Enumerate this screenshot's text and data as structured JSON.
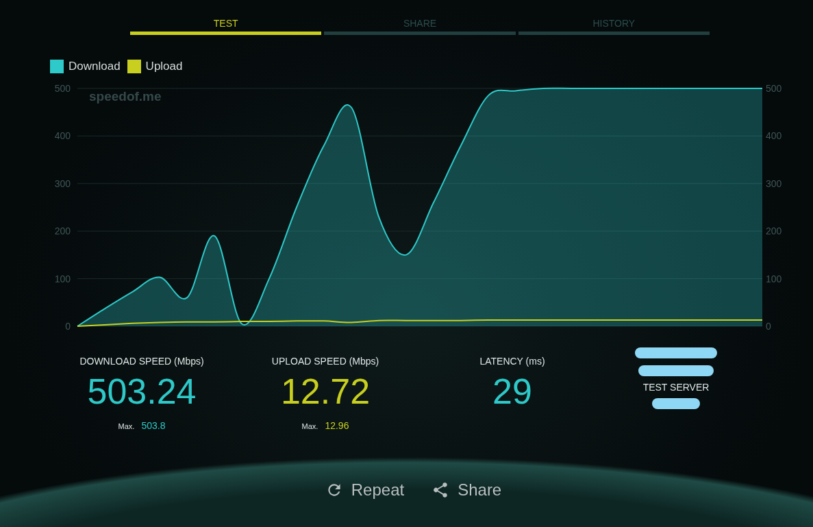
{
  "tabs": [
    {
      "label": "TEST",
      "selected": true
    },
    {
      "label": "SHARE",
      "selected": false
    },
    {
      "label": "HISTORY",
      "selected": false
    }
  ],
  "chart": {
    "brand": "speedof.me",
    "right_ticks": [
      "500",
      "400",
      "300",
      "200",
      "100",
      "0"
    ],
    "chart_data": {
      "type": "area",
      "grid": true,
      "ylim": [
        0,
        500
      ],
      "yticks": [
        0,
        100,
        200,
        300,
        400,
        500
      ],
      "series": [
        {
          "name": "Download",
          "type": "area",
          "color": "#2ec9c9",
          "values": [
            0,
            37,
            72,
            103,
            60,
            190,
            5,
            100,
            250,
            380,
            460,
            230,
            150,
            260,
            380,
            485,
            495,
            500,
            500,
            500,
            500,
            500,
            500,
            500,
            500,
            500
          ]
        },
        {
          "name": "Upload",
          "type": "line",
          "color": "#c8cf1e",
          "values": [
            0,
            3,
            6,
            8,
            9,
            9,
            10,
            10,
            11,
            11,
            8,
            12,
            12,
            12,
            12,
            13,
            13,
            13,
            13,
            13,
            13,
            13,
            13,
            13,
            13,
            13
          ]
        }
      ]
    }
  },
  "stats": [
    {
      "label": "DOWNLOAD SPEED (Mbps)",
      "value": "503.24",
      "max_label": "Max.",
      "max_value": "503.8",
      "color": "#2ec9c9"
    },
    {
      "label": "UPLOAD SPEED (Mbps)",
      "value": "12.72",
      "max_label": "Max.",
      "max_value": "12.96",
      "color": "#c8cf1e"
    },
    {
      "label": "LATENCY (ms)",
      "value": "29",
      "color": "#2ec9c9"
    }
  ],
  "server": {
    "label": "TEST SERVER"
  },
  "actions": [
    {
      "label": "Repeat",
      "kind": "repeat"
    },
    {
      "label": "Share",
      "kind": "share"
    }
  ]
}
